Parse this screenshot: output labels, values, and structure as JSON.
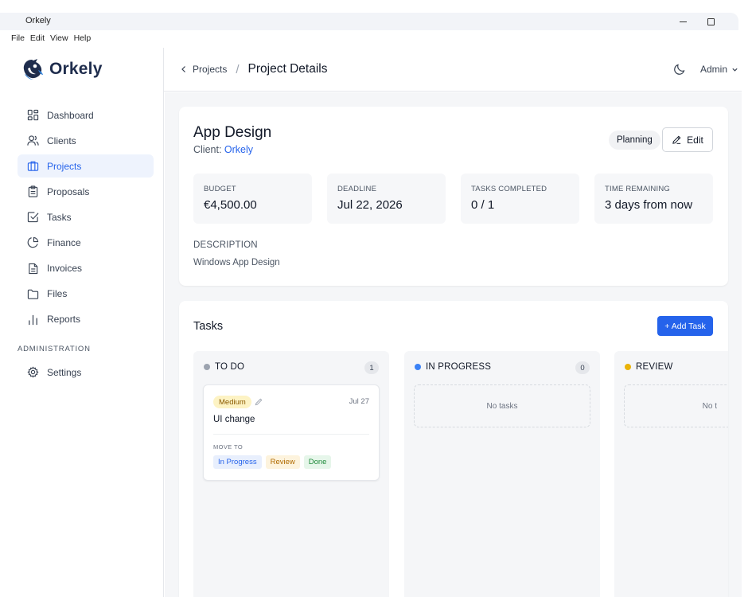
{
  "window": {
    "title": "Orkely"
  },
  "menu": [
    "File",
    "Edit",
    "View",
    "Help"
  ],
  "brand": {
    "name": "Orkely",
    "color": "#1f2d4d",
    "accent": "#2563eb"
  },
  "sidebar": {
    "items": [
      {
        "label": "Dashboard",
        "icon": "dashboard-icon"
      },
      {
        "label": "Clients",
        "icon": "users-icon"
      },
      {
        "label": "Projects",
        "icon": "briefcase-icon",
        "active": true
      },
      {
        "label": "Proposals",
        "icon": "clipboard-icon"
      },
      {
        "label": "Tasks",
        "icon": "check-square-icon"
      },
      {
        "label": "Finance",
        "icon": "pie-chart-icon"
      },
      {
        "label": "Invoices",
        "icon": "document-icon"
      },
      {
        "label": "Files",
        "icon": "folder-icon"
      },
      {
        "label": "Reports",
        "icon": "bar-chart-icon"
      }
    ],
    "admin_section": "ADMINISTRATION",
    "settings": {
      "label": "Settings",
      "icon": "gear-icon"
    }
  },
  "header": {
    "back": "Projects",
    "separator": "/",
    "title": "Project Details",
    "user": "Admin"
  },
  "project": {
    "name": "App Design",
    "client_prefix": "Client: ",
    "client": "Orkely",
    "status": "Planning",
    "edit_label": "Edit",
    "stats": [
      {
        "label": "BUDGET",
        "value": "€4,500.00"
      },
      {
        "label": "DEADLINE",
        "value": "Jul 22, 2026"
      },
      {
        "label": "TASKS COMPLETED",
        "value": "0 / 1"
      },
      {
        "label": "TIME REMAINING",
        "value": "3 days from now"
      }
    ],
    "description_label": "DESCRIPTION",
    "description": "Windows App Design"
  },
  "tasks": {
    "title": "Tasks",
    "add_label": "+ Add Task",
    "columns": [
      {
        "name": "TO DO",
        "count": "1",
        "color": "#9ca3af"
      },
      {
        "name": "IN PROGRESS",
        "count": "0",
        "color": "#3b82f6",
        "empty": "No tasks"
      },
      {
        "name": "REVIEW",
        "color": "#eab308",
        "empty": "No t"
      }
    ],
    "card": {
      "priority": "Medium",
      "date": "Jul 27",
      "name": "UI change",
      "move_to": "MOVE TO",
      "moves": [
        "In Progress",
        "Review",
        "Done"
      ]
    }
  }
}
